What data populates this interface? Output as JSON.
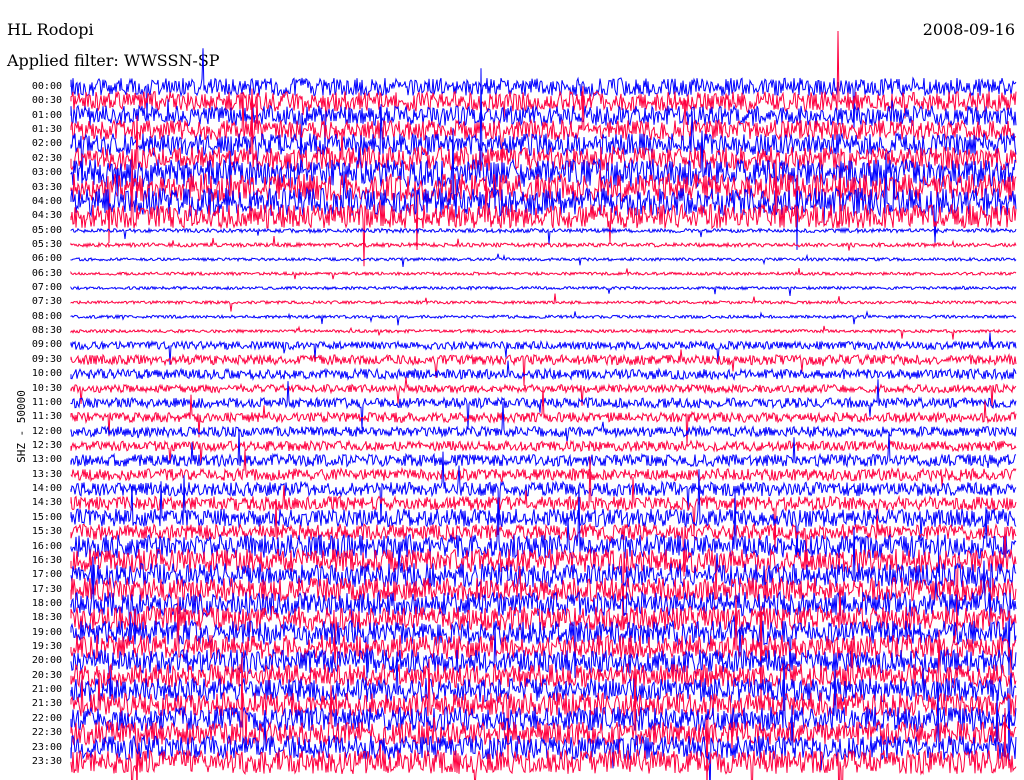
{
  "header": {
    "station": "HL Rodopi",
    "filter": "Applied filter: WWSSN-SP",
    "date": "2008-09-16"
  },
  "chart_data": {
    "type": "line",
    "title": "HL Rodopi helicorder",
    "ylabel": "SHZ - 50000",
    "colors": [
      "#0000ff",
      "#ff0040"
    ],
    "rows": [
      "00:00",
      "00:30",
      "01:00",
      "01:30",
      "02:00",
      "02:30",
      "03:00",
      "03:30",
      "04:00",
      "04:30",
      "05:00",
      "05:30",
      "06:00",
      "06:30",
      "07:00",
      "07:30",
      "08:00",
      "08:30",
      "09:00",
      "09:30",
      "10:00",
      "10:30",
      "11:00",
      "11:30",
      "12:00",
      "12:30",
      "13:00",
      "13:30",
      "14:00",
      "14:30",
      "15:00",
      "15:30",
      "16:00",
      "16:30",
      "17:00",
      "17:30",
      "18:00",
      "18:30",
      "19:00",
      "19:30",
      "20:00",
      "20:30",
      "21:00",
      "21:30",
      "22:00",
      "22:30",
      "23:00",
      "23:30"
    ],
    "relative_noise_level": [
      9,
      10,
      10,
      10,
      11,
      12,
      14,
      14,
      14,
      12,
      2,
      2,
      1.5,
      1.5,
      1.5,
      1.5,
      1.5,
      1.5,
      4,
      5,
      5,
      4,
      5,
      5,
      5,
      5,
      6,
      6,
      7,
      7,
      9,
      8,
      12,
      12,
      12,
      12,
      12,
      12,
      12,
      12,
      12,
      12,
      12,
      12,
      12,
      12,
      12,
      12
    ]
  }
}
